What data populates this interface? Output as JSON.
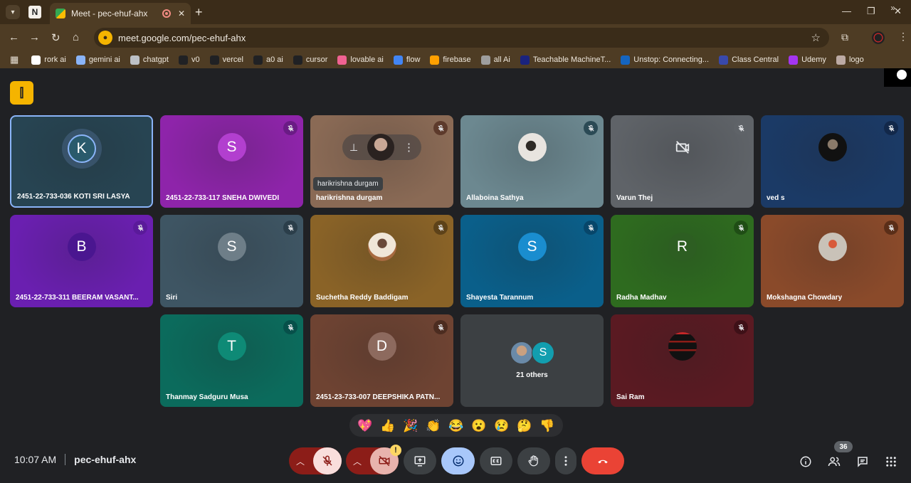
{
  "browser": {
    "tab_title": "Meet - pec-ehuf-ahx",
    "url": "meet.google.com/pec-ehuf-ahx",
    "bookmarks": [
      "rork ai",
      "gemini ai",
      "chatgpt",
      "v0",
      "vercel",
      "a0 ai",
      "cursor",
      "lovable ai",
      "flow",
      "firebase",
      "all Ai",
      "Teachable MachineT...",
      "Unstop: Connecting...",
      "Class Central",
      "Udemy",
      "logo"
    ],
    "bookmark_colors": [
      "#ffffff",
      "#8ab4f8",
      "#bdc1c6",
      "#202124",
      "#202124",
      "#202124",
      "#202124",
      "#f06292",
      "#4285f4",
      "#ffa000",
      "#9e9e9e",
      "#1a237e",
      "#1565c0",
      "#3949ab",
      "#a435f0",
      "#bcaaa4"
    ]
  },
  "meeting": {
    "code": "pec-ehuf-ahx",
    "time": "10:07 AM",
    "participant_count": "36",
    "tooltip": "harikrishna durgam",
    "others_label": "21 others",
    "others_initial": "S"
  },
  "participants": [
    {
      "name": "2451-22-733-036 KOTI SRI LASYA",
      "initial": "K",
      "bg": "#274452",
      "avatar_color": "#2a5a6c",
      "mic_color": "transparent",
      "active": true
    },
    {
      "name": "2451-22-733-117 SNEHA DWIVEDI",
      "initial": "S",
      "bg": "#8e24aa",
      "avatar_color": "#b23fcf",
      "mic_color": "#6a1b85"
    },
    {
      "name": "harikrishna durgam",
      "initial": "",
      "bg": "#8a6a55",
      "avatar_color": "",
      "mic_color": "#5d3a2b"
    },
    {
      "name": "Allaboina Sathya",
      "initial": "",
      "bg": "#6c8890",
      "avatar_color": "",
      "mic_color": "#2b4a55"
    },
    {
      "name": "Varun Thej",
      "initial": "",
      "bg": "#5f6368",
      "avatar_color": "",
      "mic_color": "#5f6368"
    },
    {
      "name": "ved s",
      "initial": "",
      "bg": "#1b3a66",
      "avatar_color": "",
      "mic_color": "#12284a"
    },
    {
      "name": "2451-22-733-311 BEERAM VASANT...",
      "initial": "B",
      "bg": "#6a1fb0",
      "avatar_color": "#4a1690",
      "mic_color": "#5a1a9a"
    },
    {
      "name": "Siri",
      "initial": "S",
      "bg": "#3e5563",
      "avatar_color": "#6e7e88",
      "mic_color": "#2b3e4a"
    },
    {
      "name": "Suchetha Reddy Baddigam",
      "initial": "",
      "bg": "#8a6327",
      "avatar_color": "",
      "mic_color": "#5d4219"
    },
    {
      "name": "Shayesta Tarannum",
      "initial": "S",
      "bg": "#0a5f8a",
      "avatar_color": "#1a8dcf",
      "mic_color": "#07466a"
    },
    {
      "name": "Radha Madhav",
      "initial": "R",
      "bg": "#2e6b1f",
      "avatar_color": "#2d5e22",
      "mic_color": "#1f4d15"
    },
    {
      "name": "Mokshagna Chowdary",
      "initial": "",
      "bg": "#8a4a2a",
      "avatar_color": "",
      "mic_color": "#5a2e18"
    },
    {
      "name": "Thanmay Sadguru Musa",
      "initial": "T",
      "bg": "#0b6b5c",
      "avatar_color": "#0e8a76",
      "mic_color": "#07504a"
    },
    {
      "name": "2451-23-733-007 DEEPSHIKA PATN...",
      "initial": "D",
      "bg": "#6e4332",
      "avatar_color": "#8d6a5e",
      "mic_color": "#4c2c20"
    },
    {
      "name": "Sai Ram",
      "initial": "",
      "bg": "#5a1a22",
      "avatar_color": "",
      "mic_color": "#3e1017"
    }
  ],
  "reactions": [
    "💖",
    "👍",
    "🎉",
    "👏",
    "😂",
    "😮",
    "😢",
    "🤔",
    "👎"
  ],
  "icons": {
    "mic_off": "mic-off-icon",
    "cam_off": "camera-off-icon",
    "present": "present-icon",
    "emoji": "emoji-icon",
    "captions": "captions-icon",
    "hand": "raise-hand-icon",
    "more": "more-options-icon",
    "end": "end-call-icon",
    "info": "info-icon",
    "people": "people-icon",
    "chat": "chat-icon",
    "activities": "activities-icon"
  },
  "colors": {
    "end_call": "#ea4335",
    "mic_cam_off": "#f9dedc",
    "arrow_btn": "#8c1d18",
    "emoji_active": "#a8c7fa"
  }
}
